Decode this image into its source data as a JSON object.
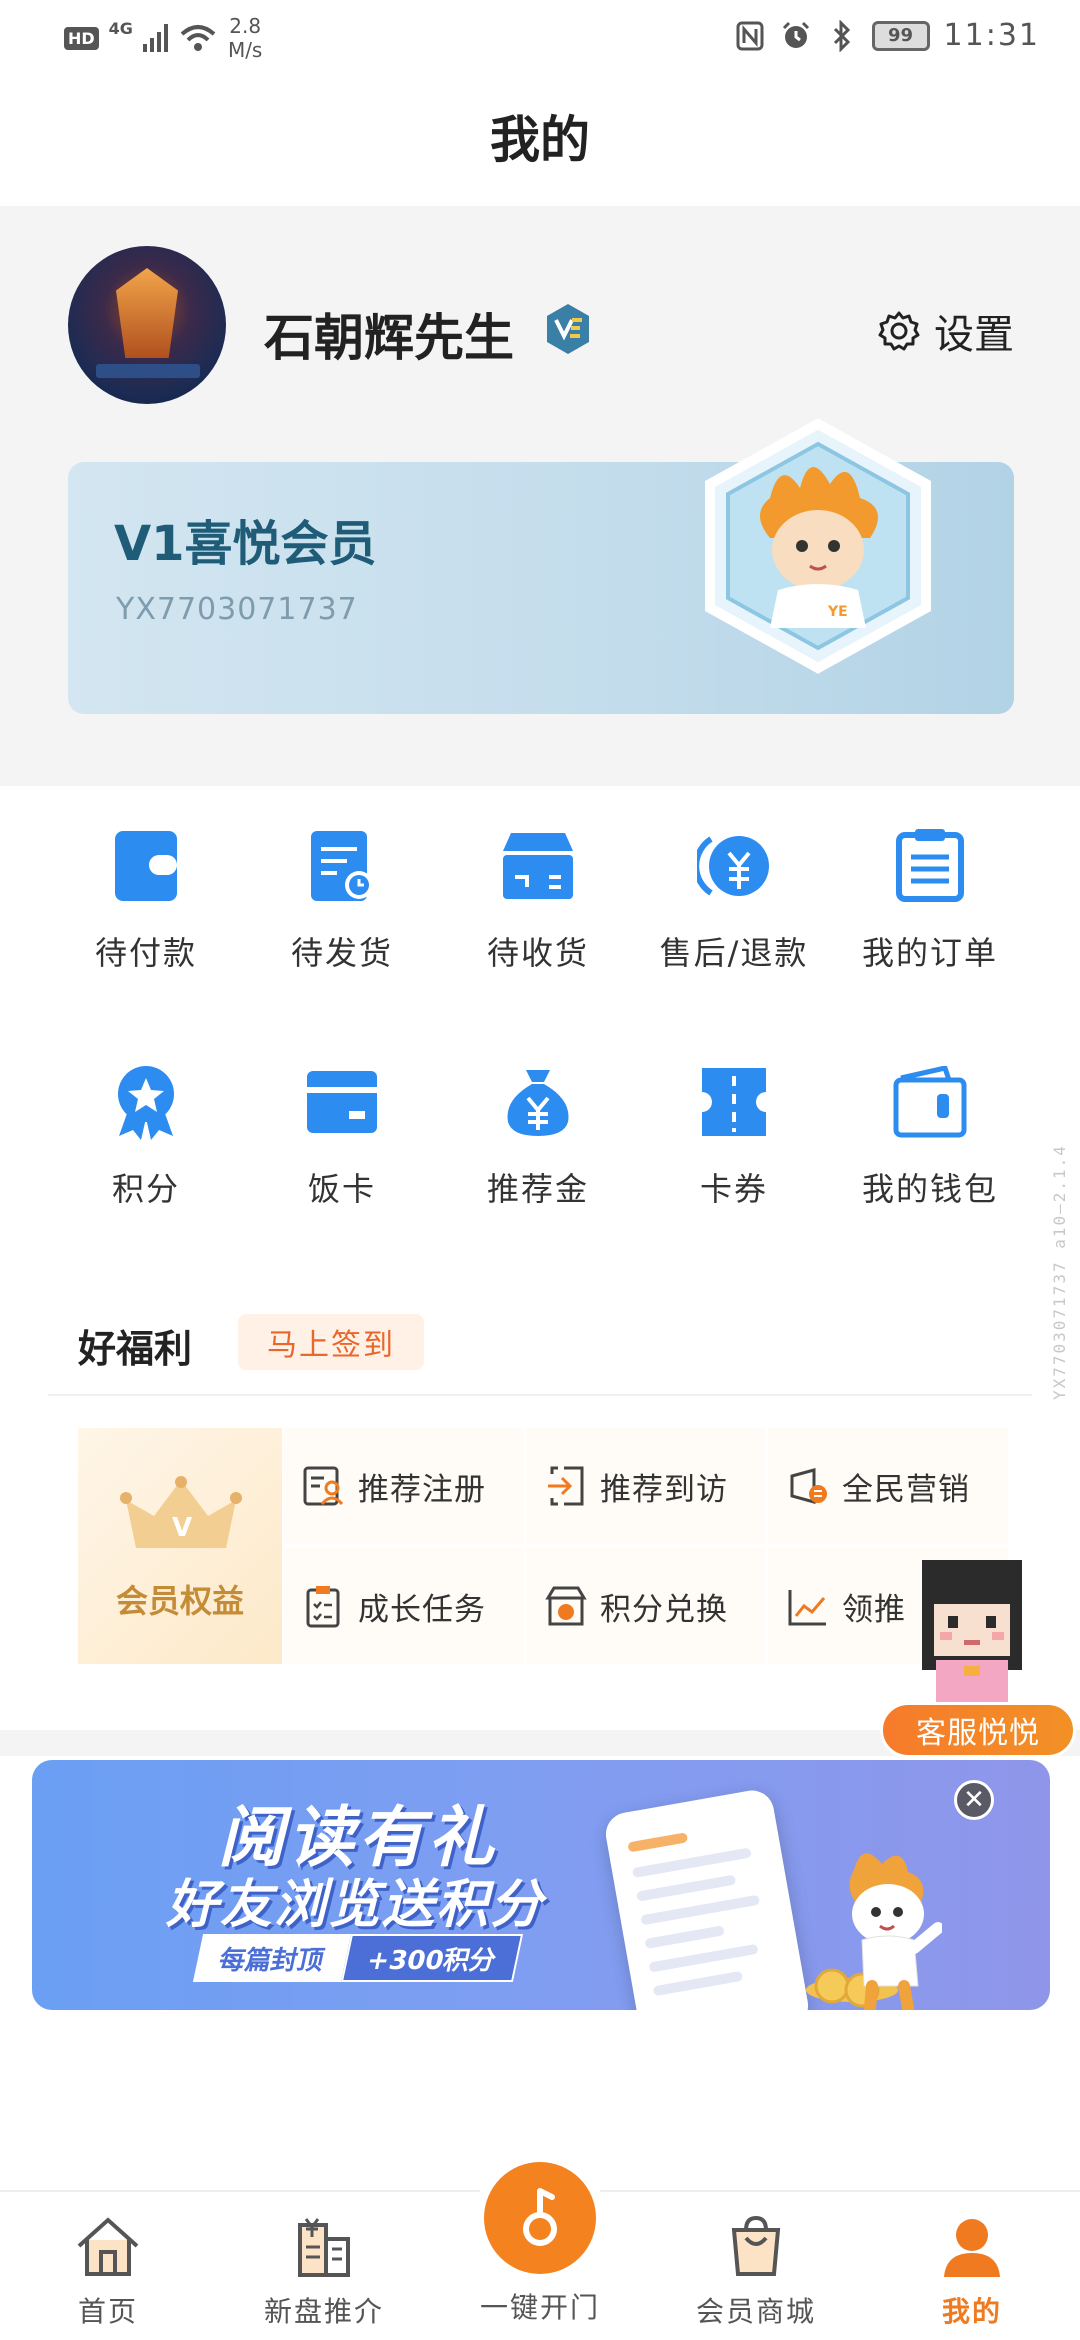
{
  "status_bar": {
    "hd": "HD",
    "network": "4G",
    "speed_value": "2.8",
    "speed_unit": "M/s",
    "battery": "99",
    "time": "11:31"
  },
  "header": {
    "title": "我的"
  },
  "profile": {
    "username": "石朝辉先生",
    "settings_label": "设置",
    "member_level": "V1喜悦会员",
    "member_id": "YX7703071737"
  },
  "orders": [
    {
      "label": "待付款",
      "icon": "wallet-icon"
    },
    {
      "label": "待发货",
      "icon": "document-clock-icon"
    },
    {
      "label": "待收货",
      "icon": "package-icon"
    },
    {
      "label": "售后/退款",
      "icon": "refund-icon"
    },
    {
      "label": "我的订单",
      "icon": "order-list-icon"
    }
  ],
  "assets": [
    {
      "label": "积分",
      "icon": "points-medal-icon"
    },
    {
      "label": "饭卡",
      "icon": "meal-card-icon"
    },
    {
      "label": "推荐金",
      "icon": "money-bag-icon"
    },
    {
      "label": "卡券",
      "icon": "coupon-icon"
    },
    {
      "label": "我的钱包",
      "icon": "purse-icon"
    }
  ],
  "welfare": {
    "title": "好福利",
    "signin_label": "马上签到",
    "vip_label": "会员权益",
    "items": [
      {
        "label": "推荐注册",
        "icon": "register-icon"
      },
      {
        "label": "推荐到访",
        "icon": "visit-icon"
      },
      {
        "label": "全民营销",
        "icon": "marketing-icon"
      },
      {
        "label": "成长任务",
        "icon": "task-icon"
      },
      {
        "label": "积分兑换",
        "icon": "exchange-icon"
      },
      {
        "label": "领推",
        "icon": "chart-icon"
      }
    ]
  },
  "customer_service": {
    "label": "客服悦悦"
  },
  "banner": {
    "title": "阅读有礼",
    "subtitle": "好友浏览送积分",
    "tag_left": "每篇封顶",
    "tag_right": "+300积分"
  },
  "bottom_nav": {
    "items": [
      {
        "label": "首页",
        "icon": "home-icon"
      },
      {
        "label": "新盘推介",
        "icon": "building-icon"
      },
      {
        "label": "一键开门",
        "icon": "key-icon"
      },
      {
        "label": "会员商城",
        "icon": "shopping-bag-icon"
      },
      {
        "label": "我的",
        "icon": "person-icon"
      }
    ],
    "active": "我的"
  },
  "watermark": "YX7703071737 a10—2.1.4",
  "colors": {
    "accent": "#f07a1f",
    "icon_blue": "#2d8cf0",
    "member_text": "#1f5c78",
    "signin_text": "#e8682b"
  }
}
